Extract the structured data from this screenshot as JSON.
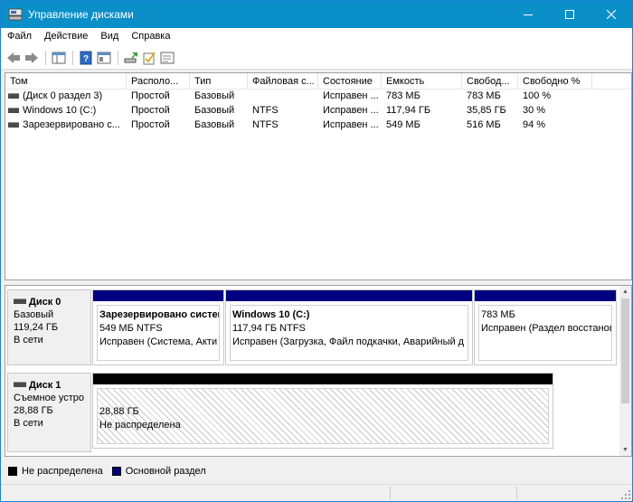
{
  "window": {
    "title": "Управление дисками",
    "controls": {
      "minimize": "minimize-icon",
      "maximize": "maximize-icon",
      "close": "close-icon"
    }
  },
  "menu": [
    "Файл",
    "Действие",
    "Вид",
    "Справка"
  ],
  "toolbar": {
    "icons": [
      "back-arrow-icon",
      "forward-arrow-icon",
      "console-tree-icon",
      "help-icon",
      "properties-icon",
      "connect-disk-icon",
      "check-icon",
      "wizard-icon"
    ]
  },
  "volume_table": {
    "headers": [
      "Том",
      "Располо...",
      "Тип",
      "Файловая с...",
      "Состояние",
      "Емкость",
      "Свобод...",
      "Свободно %"
    ],
    "rows": [
      [
        "(Диск 0 раздел 3)",
        "Простой",
        "Базовый",
        "",
        "Исправен ...",
        "783 МБ",
        "783 МБ",
        "100 %"
      ],
      [
        "Windows 10 (C:)",
        "Простой",
        "Базовый",
        "NTFS",
        "Исправен ...",
        "117,94 ГБ",
        "35,85 ГБ",
        "30 %"
      ],
      [
        "Зарезервировано с...",
        "Простой",
        "Базовый",
        "NTFS",
        "Исправен ...",
        "549 МБ",
        "516 МБ",
        "94 %"
      ]
    ]
  },
  "disks": [
    {
      "name": "Диск 0",
      "type": "Базовый",
      "size": "119,24 ГБ",
      "status": "В сети",
      "partitions": [
        {
          "name": "Зарезервировано систем",
          "size": "549 МБ NTFS",
          "status": "Исправен (Система, Акти",
          "kind": "primary"
        },
        {
          "name": "Windows 10  (C:)",
          "size": "117,94 ГБ NTFS",
          "status": "Исправен (Загрузка, Файл подкачки, Аварийный д",
          "kind": "primary"
        },
        {
          "name": "",
          "size": "783 МБ",
          "status": "Исправен (Раздел восстанов",
          "kind": "primary"
        }
      ]
    },
    {
      "name": "Диск 1",
      "type": "Съемное устро",
      "size": "28,88 ГБ",
      "status": "В сети",
      "partitions": [
        {
          "name": "",
          "size": "28,88 ГБ",
          "status": "Не распределена",
          "kind": "unallocated"
        }
      ]
    }
  ],
  "legend": [
    {
      "label": "Не распределена",
      "color": "#000000"
    },
    {
      "label": "Основной раздел",
      "color": "#000080"
    }
  ],
  "colors": {
    "titlebar": "#0b8fc8",
    "primary_partition": "#000080",
    "unallocated": "#000000"
  }
}
